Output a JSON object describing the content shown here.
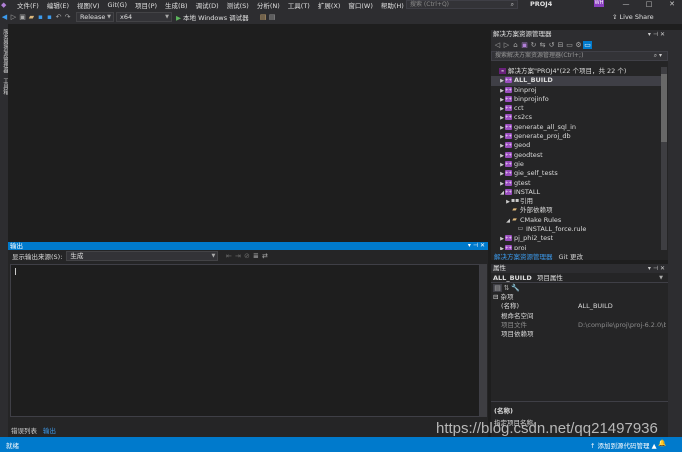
{
  "menubar": {
    "items": [
      "文件(F)",
      "编辑(E)",
      "视图(V)",
      "Git(G)",
      "项目(P)",
      "生成(B)",
      "调试(D)",
      "测试(S)",
      "分析(N)",
      "工具(T)",
      "扩展(X)",
      "窗口(W)",
      "帮助(H)"
    ],
    "search_placeholder": "搜索 (Ctrl+Q)",
    "project_name": "PROJ4",
    "avatar": "WH",
    "win_minimize": "—",
    "win_maximize": "□",
    "win_close": "✕"
  },
  "toolbar": {
    "configuration": "Release",
    "platform": "x64",
    "run_label": "本地 Windows 调试器",
    "liveshare": "Live Share"
  },
  "left_strip": {
    "tabs": [
      "服务器资源管理器",
      "工具箱"
    ]
  },
  "output": {
    "title": "输出",
    "source_label": "显示输出来源(S):",
    "source_value": "生成",
    "bottom_tabs": [
      "错误列表",
      "输出"
    ]
  },
  "solution_explorer": {
    "title": "解决方案资源管理器",
    "search_placeholder": "搜索解决方案资源管理器(Ctrl+;)",
    "items": [
      {
        "label": "解决方案\"PROJ4\"(22 个项目，共 22 个)",
        "level": 0,
        "kind": "sln",
        "expander": ""
      },
      {
        "label": "ALL_BUILD",
        "level": 1,
        "kind": "proj",
        "expander": "▶",
        "bold": true,
        "selected": true
      },
      {
        "label": "binproj",
        "level": 1,
        "kind": "proj",
        "expander": "▶"
      },
      {
        "label": "binprojinfo",
        "level": 1,
        "kind": "proj",
        "expander": "▶"
      },
      {
        "label": "cct",
        "level": 1,
        "kind": "proj",
        "expander": "▶"
      },
      {
        "label": "cs2cs",
        "level": 1,
        "kind": "proj",
        "expander": "▶"
      },
      {
        "label": "generate_all_sql_in",
        "level": 1,
        "kind": "proj",
        "expander": "▶"
      },
      {
        "label": "generate_proj_db",
        "level": 1,
        "kind": "proj",
        "expander": "▶"
      },
      {
        "label": "geod",
        "level": 1,
        "kind": "proj",
        "expander": "▶"
      },
      {
        "label": "geodtest",
        "level": 1,
        "kind": "proj",
        "expander": "▶"
      },
      {
        "label": "gie",
        "level": 1,
        "kind": "proj",
        "expander": "▶"
      },
      {
        "label": "gie_self_tests",
        "level": 1,
        "kind": "proj",
        "expander": "▶"
      },
      {
        "label": "gtest",
        "level": 1,
        "kind": "proj",
        "expander": "▶"
      },
      {
        "label": "INSTALL",
        "level": 1,
        "kind": "proj",
        "expander": "◢"
      },
      {
        "label": "引用",
        "level": 2,
        "kind": "ref",
        "expander": "▶"
      },
      {
        "label": "外部依赖项",
        "level": 2,
        "kind": "folder",
        "expander": ""
      },
      {
        "label": "CMake Rules",
        "level": 2,
        "kind": "folder",
        "expander": "◢"
      },
      {
        "label": "INSTALL_force.rule",
        "level": 3,
        "kind": "file",
        "expander": ""
      },
      {
        "label": "pj_phi2_test",
        "level": 1,
        "kind": "proj",
        "expander": "▶"
      },
      {
        "label": "proj",
        "level": 1,
        "kind": "proj",
        "expander": "▶"
      }
    ],
    "bottom_tabs": [
      "解决方案资源管理器",
      "Git 更改"
    ]
  },
  "properties": {
    "title": "属性",
    "object_name": "ALL_BUILD",
    "object_type": "项目属性",
    "category": "杂项",
    "rows": [
      {
        "name": "(名称)",
        "value": "ALL_BUILD",
        "dim": false
      },
      {
        "name": "根命名空间",
        "value": "",
        "dim": false
      },
      {
        "name": "项目文件",
        "value": "D:\\compile\\proj\\proj-6.2.0\\bu",
        "dim": true
      },
      {
        "name": "项目依赖项",
        "value": "",
        "dim": false
      }
    ],
    "desc_title": "(名称)",
    "desc_text": "指定项目名称。"
  },
  "statusbar": {
    "ready": "就绪",
    "source_control": "↑ 添加到源代码管理 ▲",
    "bell": "🔔"
  },
  "watermark": "https://blog.csdn.net/qq21497936",
  "colors": {
    "accent": "#007acc",
    "background": "#1e1e1e",
    "panel": "#252526",
    "chrome": "#2d2d30"
  }
}
